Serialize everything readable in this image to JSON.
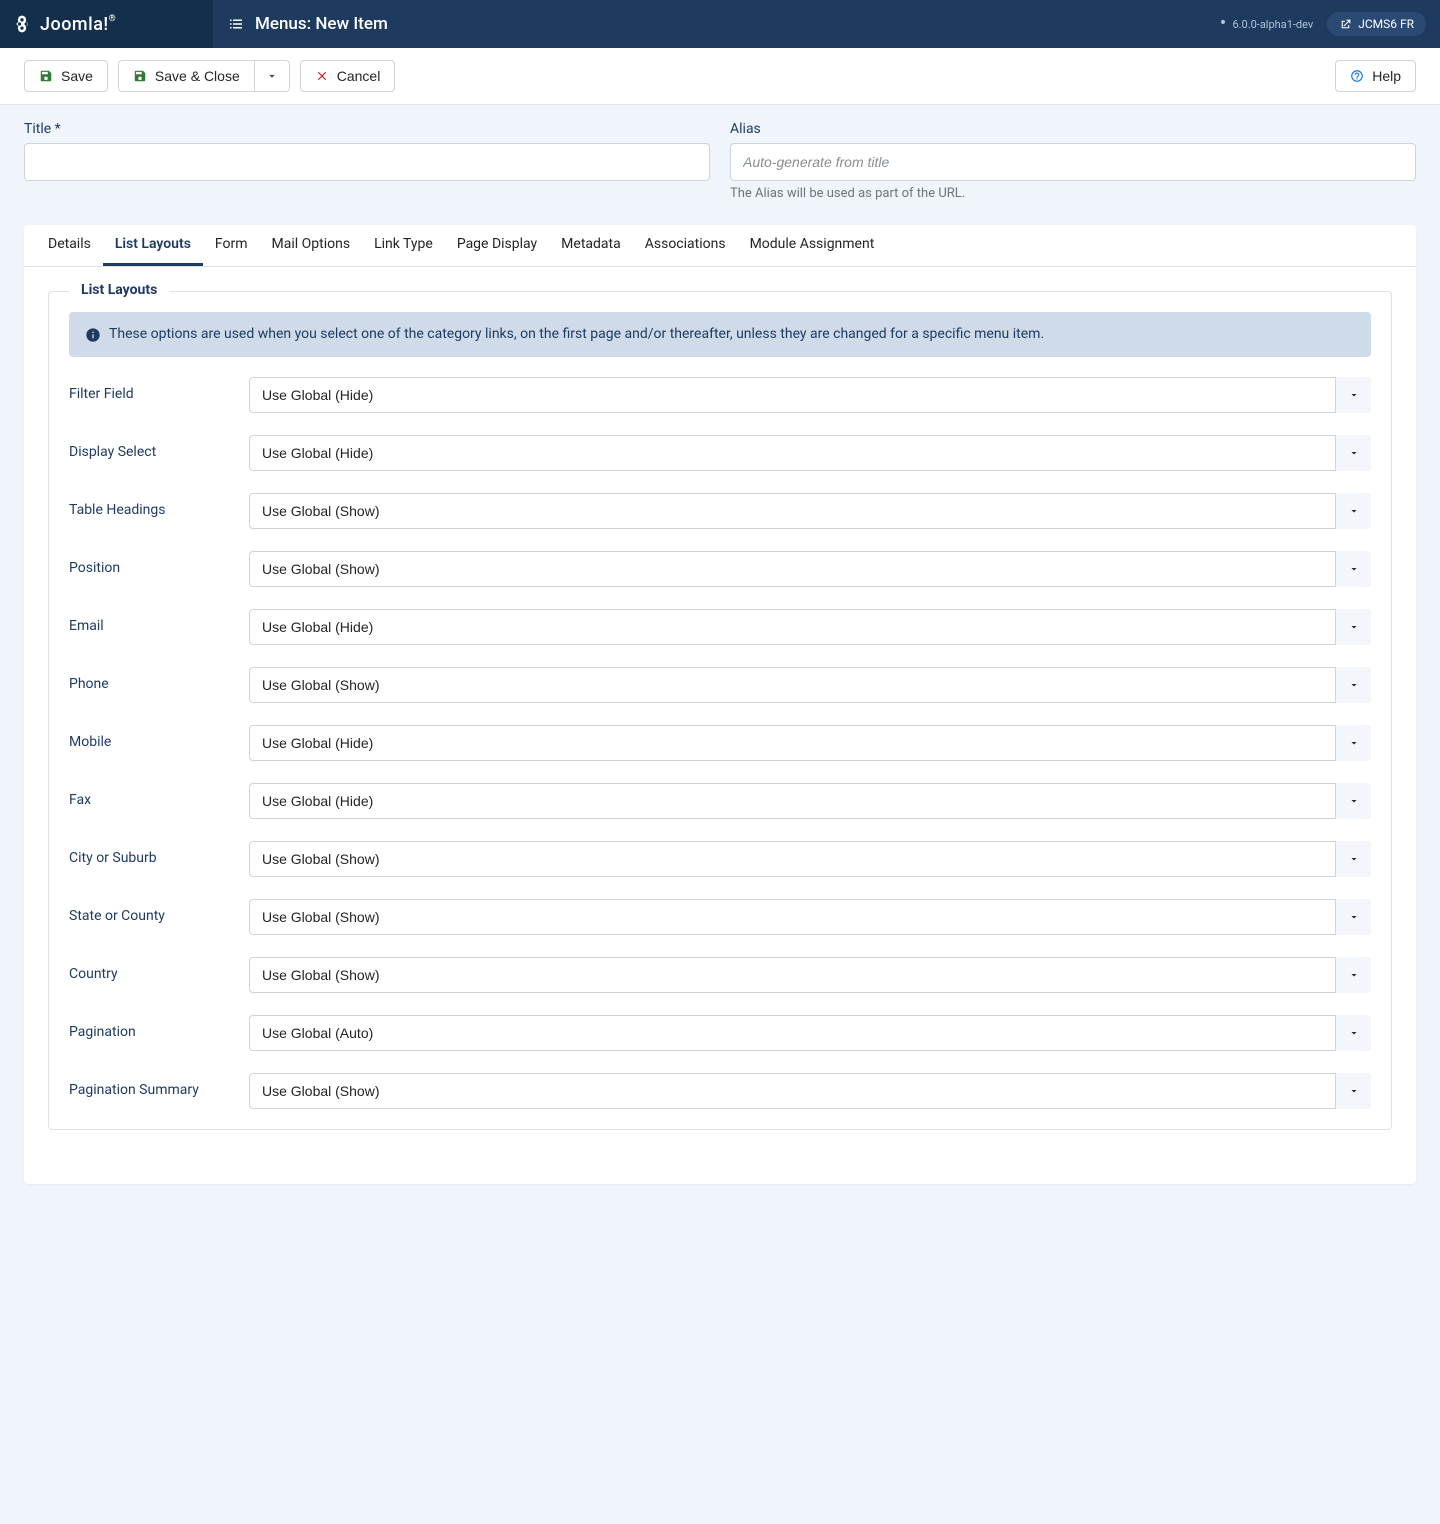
{
  "topbar": {
    "brand": "Joomla!",
    "page_title": "Menus: New Item",
    "version": "6.0.0-alpha1-dev",
    "site_name": "JCMS6 FR"
  },
  "toolbar": {
    "save": "Save",
    "save_close": "Save & Close",
    "cancel": "Cancel",
    "help": "Help"
  },
  "fields": {
    "title_label": "Title *",
    "title_value": "",
    "alias_label": "Alias",
    "alias_placeholder": "Auto-generate from title",
    "alias_hint": "The Alias will be used as part of the URL."
  },
  "tabs": [
    "Details",
    "List Layouts",
    "Form",
    "Mail Options",
    "Link Type",
    "Page Display",
    "Metadata",
    "Associations",
    "Module Assignment"
  ],
  "active_tab": 1,
  "fieldset": {
    "legend": "List Layouts",
    "info": "These options are used when you select one of the category links, on the first page and/or thereafter, unless they are changed for a specific menu item.",
    "controls": [
      {
        "label": "Filter Field",
        "value": "Use Global (Hide)"
      },
      {
        "label": "Display Select",
        "value": "Use Global (Hide)"
      },
      {
        "label": "Table Headings",
        "value": "Use Global (Show)"
      },
      {
        "label": "Position",
        "value": "Use Global (Show)"
      },
      {
        "label": "Email",
        "value": "Use Global (Hide)"
      },
      {
        "label": "Phone",
        "value": "Use Global (Show)"
      },
      {
        "label": "Mobile",
        "value": "Use Global (Hide)"
      },
      {
        "label": "Fax",
        "value": "Use Global (Hide)"
      },
      {
        "label": "City or Suburb",
        "value": "Use Global (Show)"
      },
      {
        "label": "State or County",
        "value": "Use Global (Show)"
      },
      {
        "label": "Country",
        "value": "Use Global (Show)"
      },
      {
        "label": "Pagination",
        "value": "Use Global (Auto)"
      },
      {
        "label": "Pagination Summary",
        "value": "Use Global (Show)"
      }
    ]
  }
}
